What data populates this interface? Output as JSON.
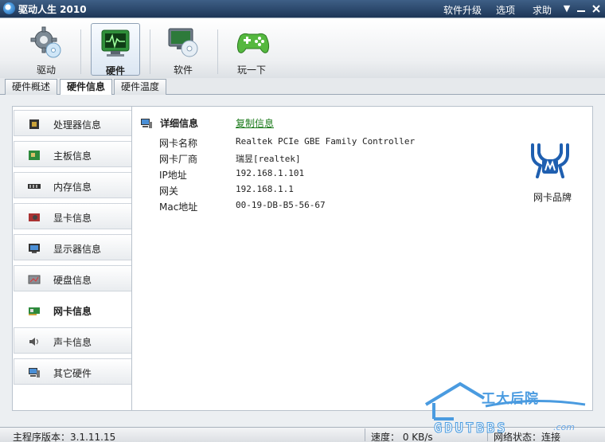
{
  "app": {
    "title": "驱动人生 2010"
  },
  "title_menu": {
    "upgrade": "软件升级",
    "options": "选项",
    "help": "求助"
  },
  "toolbar": [
    {
      "label": "驱动",
      "icon": "gear-cd-icon"
    },
    {
      "label": "硬件",
      "icon": "monitor-pulse-icon"
    },
    {
      "label": "软件",
      "icon": "monitor-disc-icon"
    },
    {
      "label": "玩一下",
      "icon": "gamepad-icon"
    }
  ],
  "tabs": [
    "硬件概述",
    "硬件信息",
    "硬件温度"
  ],
  "active_tab": "硬件信息",
  "sidebar": [
    {
      "label": "处理器信息",
      "icon": "cpu-icon"
    },
    {
      "label": "主板信息",
      "icon": "motherboard-icon"
    },
    {
      "label": "内存信息",
      "icon": "memory-icon"
    },
    {
      "label": "显卡信息",
      "icon": "graphics-card-icon"
    },
    {
      "label": "显示器信息",
      "icon": "monitor-icon"
    },
    {
      "label": "硬盘信息",
      "icon": "harddisk-icon"
    },
    {
      "label": "网卡信息",
      "icon": "network-card-icon"
    },
    {
      "label": "声卡信息",
      "icon": "speaker-icon"
    },
    {
      "label": "其它硬件",
      "icon": "computer-icon"
    }
  ],
  "active_sidebar": "网卡信息",
  "detail": {
    "title": "详细信息",
    "copy_link": "复制信息",
    "rows": [
      {
        "key": "网卡名称",
        "value": "Realtek PCIe GBE Family Controller"
      },
      {
        "key": "网卡厂商",
        "value": "瑞昱[realtek]"
      },
      {
        "key": "IP地址",
        "value": "192.168.1.101"
      },
      {
        "key": "网关",
        "value": "192.168.1.1"
      },
      {
        "key": "Mac地址",
        "value": "00-19-DB-B5-56-67"
      }
    ],
    "brand_label": "网卡品牌"
  },
  "status": {
    "version": "主程序版本：3.1.11.15",
    "speed": "速度：  0 KB/s",
    "net": "网络状态：连接"
  },
  "watermark": {
    "text": "工大后院",
    "site": "GDUTBBS",
    "com": ".com"
  },
  "colors": {
    "titlebar": "#1d3657",
    "link": "#1a7a1a",
    "brand_blue": "#1f5fb0",
    "watermark": "#4a9be0"
  }
}
